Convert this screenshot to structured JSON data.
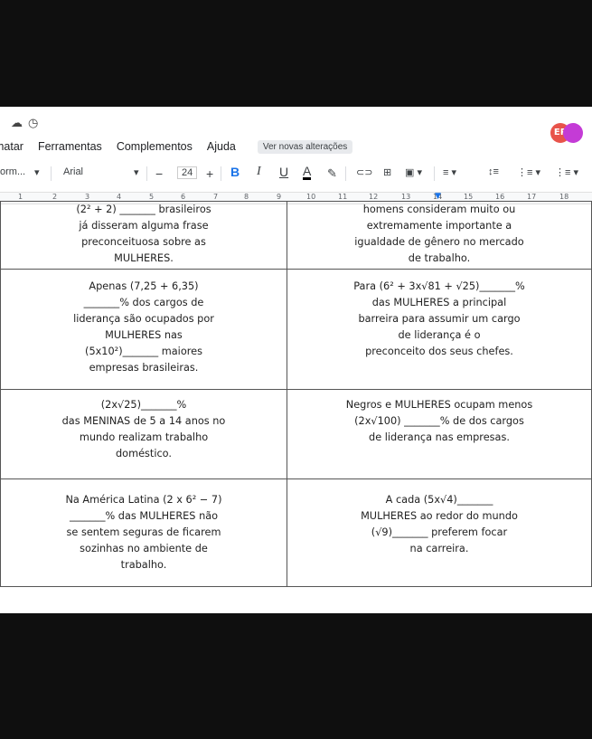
{
  "topbar": {
    "icons": [
      "cloud-icon",
      "clock-icon"
    ]
  },
  "menu": {
    "items": [
      "matar",
      "Ferramentas",
      "Complementos",
      "Ajuda"
    ],
    "notice": "Ver novas alterações"
  },
  "avatar": {
    "label": "EP"
  },
  "toolbar": {
    "style": "orm...",
    "font": "Arial",
    "minus": "−",
    "size": "24",
    "plus": "+",
    "bold": "B",
    "italic": "I",
    "underline": "U",
    "textcolor": "A",
    "highlight": "✎",
    "link": "⊂⊃",
    "comment": "⊞",
    "image": "▣ ▾",
    "align": "≡ ▾",
    "spacing": "↕≡",
    "checklist": "⋮≡ ▾",
    "bullets": "⋮≡ ▾"
  },
  "ruler": {
    "ticks": [
      "1",
      "2",
      "3",
      "4",
      "5",
      "6",
      "7",
      "8",
      "9",
      "10",
      "11",
      "12",
      "13",
      "14",
      "15",
      "16",
      "17",
      "18"
    ]
  },
  "table": {
    "rows": [
      {
        "left": [
          "(2² + 2) _______ brasileiros",
          "já disseram alguma frase",
          "preconceituosa sobre as",
          "MULHERES."
        ],
        "right": [
          "homens consideram muito ou",
          "extremamente importante a",
          "igualdade de gênero no mercado",
          "de trabalho."
        ]
      },
      {
        "left": [
          "Apenas (7,25 + 6,35)",
          "_______% dos cargos de",
          "liderança são ocupados por",
          "MULHERES nas",
          "(5x10²)_______ maiores",
          "empresas brasileiras."
        ],
        "right": [
          "Para (6² + 3x√81 + √25)_______%",
          "das MULHERES a principal",
          "barreira para assumir um cargo",
          "de liderança é o",
          "preconceito dos seus chefes."
        ]
      },
      {
        "left": [
          "(2x√25)_______%",
          "das MENINAS de 5 a 14 anos no",
          "mundo realizam trabalho",
          "doméstico."
        ],
        "right": [
          "Negros e MULHERES ocupam menos",
          "(2x√100) _______% de dos cargos",
          "de liderança nas empresas."
        ]
      },
      {
        "left": [
          "Na América Latina (2 x 6² − 7)",
          "_______% das MULHERES não",
          "se sentem seguras de ficarem",
          "sozinhas no ambiente de",
          "trabalho."
        ],
        "right": [
          "A cada (5x√4)_______",
          "MULHERES ao redor do mundo",
          "(√9)_______ preferem focar",
          "na carreira."
        ]
      }
    ]
  }
}
